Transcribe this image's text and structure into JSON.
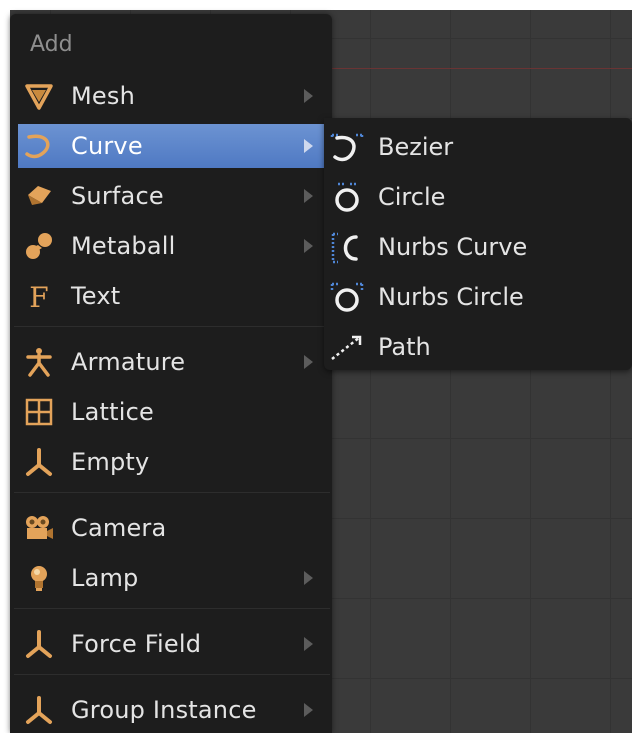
{
  "menu": {
    "title": "Add",
    "items": [
      {
        "label": "Mesh",
        "icon": "mesh-icon",
        "has_submenu": true
      },
      {
        "label": "Curve",
        "icon": "curve-icon",
        "has_submenu": true,
        "active": true
      },
      {
        "label": "Surface",
        "icon": "surface-icon",
        "has_submenu": true
      },
      {
        "label": "Metaball",
        "icon": "metaball-icon",
        "has_submenu": true
      },
      {
        "label": "Text",
        "icon": "text-icon",
        "has_submenu": false
      },
      {
        "label": "Armature",
        "icon": "armature-icon",
        "has_submenu": true
      },
      {
        "label": "Lattice",
        "icon": "lattice-icon",
        "has_submenu": false
      },
      {
        "label": "Empty",
        "icon": "empty-icon",
        "has_submenu": false
      },
      {
        "label": "Camera",
        "icon": "camera-icon",
        "has_submenu": false
      },
      {
        "label": "Lamp",
        "icon": "lamp-icon",
        "has_submenu": true
      },
      {
        "label": "Force Field",
        "icon": "force-field-icon",
        "has_submenu": true
      },
      {
        "label": "Group Instance",
        "icon": "group-instance-icon",
        "has_submenu": true
      }
    ]
  },
  "submenu": {
    "items": [
      {
        "label": "Bezier",
        "icon": "bezier-curve-icon"
      },
      {
        "label": "Circle",
        "icon": "circle-curve-icon"
      },
      {
        "label": "Nurbs Curve",
        "icon": "nurbs-curve-icon"
      },
      {
        "label": "Nurbs Circle",
        "icon": "nurbs-circle-icon"
      },
      {
        "label": "Path",
        "icon": "path-icon"
      }
    ]
  },
  "colors": {
    "menu_bg": "#1d1d1d",
    "highlight": "#5a82c8",
    "text": "#e4e4e4",
    "title": "#8e8e8e",
    "icon_orange": "#e3a35a",
    "vertex_blue": "#4f86d6"
  }
}
